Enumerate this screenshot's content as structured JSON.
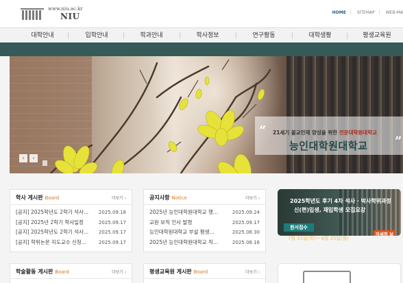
{
  "header": {
    "logo_url": "www.niu.ac.kr",
    "logo_name": "NIU",
    "util_links": [
      "HOME",
      "SITEMAP",
      "WEB-MA"
    ]
  },
  "gnb": [
    "대학안내",
    "입학안내",
    "학과안내",
    "학사정보",
    "연구활동",
    "대학생활",
    "평생교육원"
  ],
  "hero": {
    "subtitle_prefix": "21세기 불교인재 양성을 위한",
    "subtitle_highlight": "전문대학원대학교",
    "title": "능인대학원대학교",
    "prev_icon": "‹",
    "next_icon": "›"
  },
  "boards": {
    "academic": {
      "title": "학사 게시판",
      "title_en": "Board",
      "more": "더보기 ›",
      "rows": [
        {
          "title": "[공지] 2025학년도 2학기 석사...",
          "date": "2025.09.18"
        },
        {
          "title": "[공지] 2025년 2학기 학사일정",
          "date": "2025.09.17"
        },
        {
          "title": "[공지] 2025학년도 2학기 석사...",
          "date": "2025.09.17"
        },
        {
          "title": "[공지] 학위논문 지도교수 신청...",
          "date": "2025.09.17"
        }
      ]
    },
    "notice": {
      "title": "공지사항",
      "title_en": "Notice",
      "more": "더보기 ›",
      "rows": [
        {
          "title": "2025년 능인대학원대학교 행...",
          "date": "2025.09.24"
        },
        {
          "title": "교원 보직 인사 발령",
          "date": "2025.09.17"
        },
        {
          "title": "능인대학원대학교 부설 평생...",
          "date": "2025.08.30"
        },
        {
          "title": "2025년 능인대학원대학교 직...",
          "date": "2025.08.16"
        }
      ]
    },
    "activity": {
      "title": "학술활동 게시판",
      "title_en": "Board",
      "more": "더보기 ›"
    },
    "lifelong": {
      "title": "평생교육원 게시판",
      "title_en": "Board",
      "more": "더보기 ›"
    }
  },
  "banner": {
    "line1": "2025학년도 후기 4차 석사 · 박사학위과정",
    "line2": "신(편)입생, 재입학생 모집요강",
    "badge": "원서접수",
    "date": "7월 31일(목)~ 8월 25일(월)",
    "button": "자세히 보기"
  }
}
